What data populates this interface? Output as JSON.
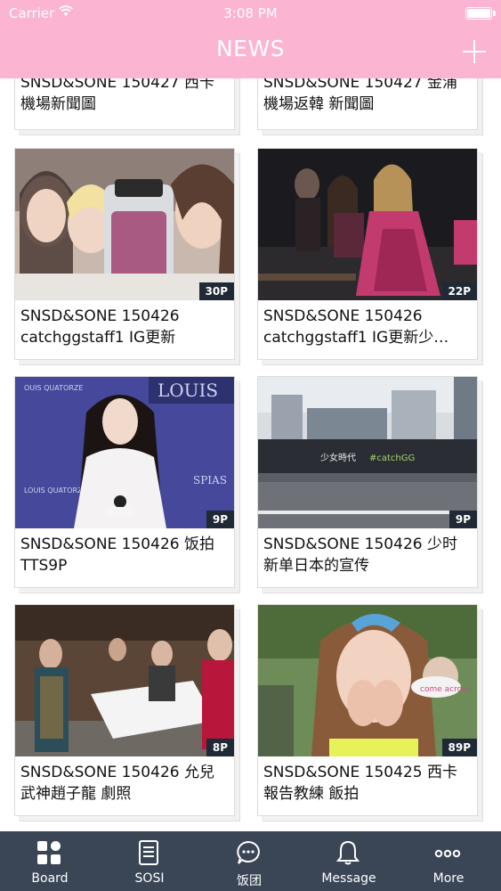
{
  "status_bar": {
    "carrier": "Carrier",
    "time": "3:08 PM"
  },
  "nav": {
    "title": "NEWS",
    "add_icon": "plus-icon"
  },
  "colors": {
    "nav_bg": "#fbb4d2",
    "tab_bg": "#3a4556",
    "badge_bg": "#1f2a36"
  },
  "partial_cards": [
    {
      "line1": "SNSD&SONE 150427 西卡",
      "line2": "機場新聞圖"
    },
    {
      "line1": "SNSD&SONE 150427 金浦",
      "line2": "機場返韓 新聞圖"
    }
  ],
  "cards": [
    {
      "count": "30P",
      "line1": "SNSD&SONE 150426",
      "line2": "catchggstaff1 IG更新"
    },
    {
      "count": "22P",
      "line1": "SNSD&SONE 150426",
      "line2": "catchggstaff1 IG更新少…"
    },
    {
      "count": "9P",
      "line1": "SNSD&SONE 150426 饭拍",
      "line2": "TTS9P"
    },
    {
      "count": "9P",
      "line1": "SNSD&SONE 150426 少时",
      "line2": "新单日本的宣传"
    },
    {
      "count": "8P",
      "line1": "SNSD&SONE 150426 允兒",
      "line2": "武神趙子龍 劇照"
    },
    {
      "count": "89P",
      "line1": "SNSD&SONE 150425 西卡",
      "line2": "報告教練 飯拍"
    }
  ],
  "tabs": [
    {
      "label": "Board",
      "icon": "grid-icon"
    },
    {
      "label": "SOSI",
      "icon": "document-icon"
    },
    {
      "label": "饭团",
      "icon": "chat-bubble-icon"
    },
    {
      "label": "Message",
      "icon": "bell-icon"
    },
    {
      "label": "More",
      "icon": "more-dots-icon"
    }
  ]
}
